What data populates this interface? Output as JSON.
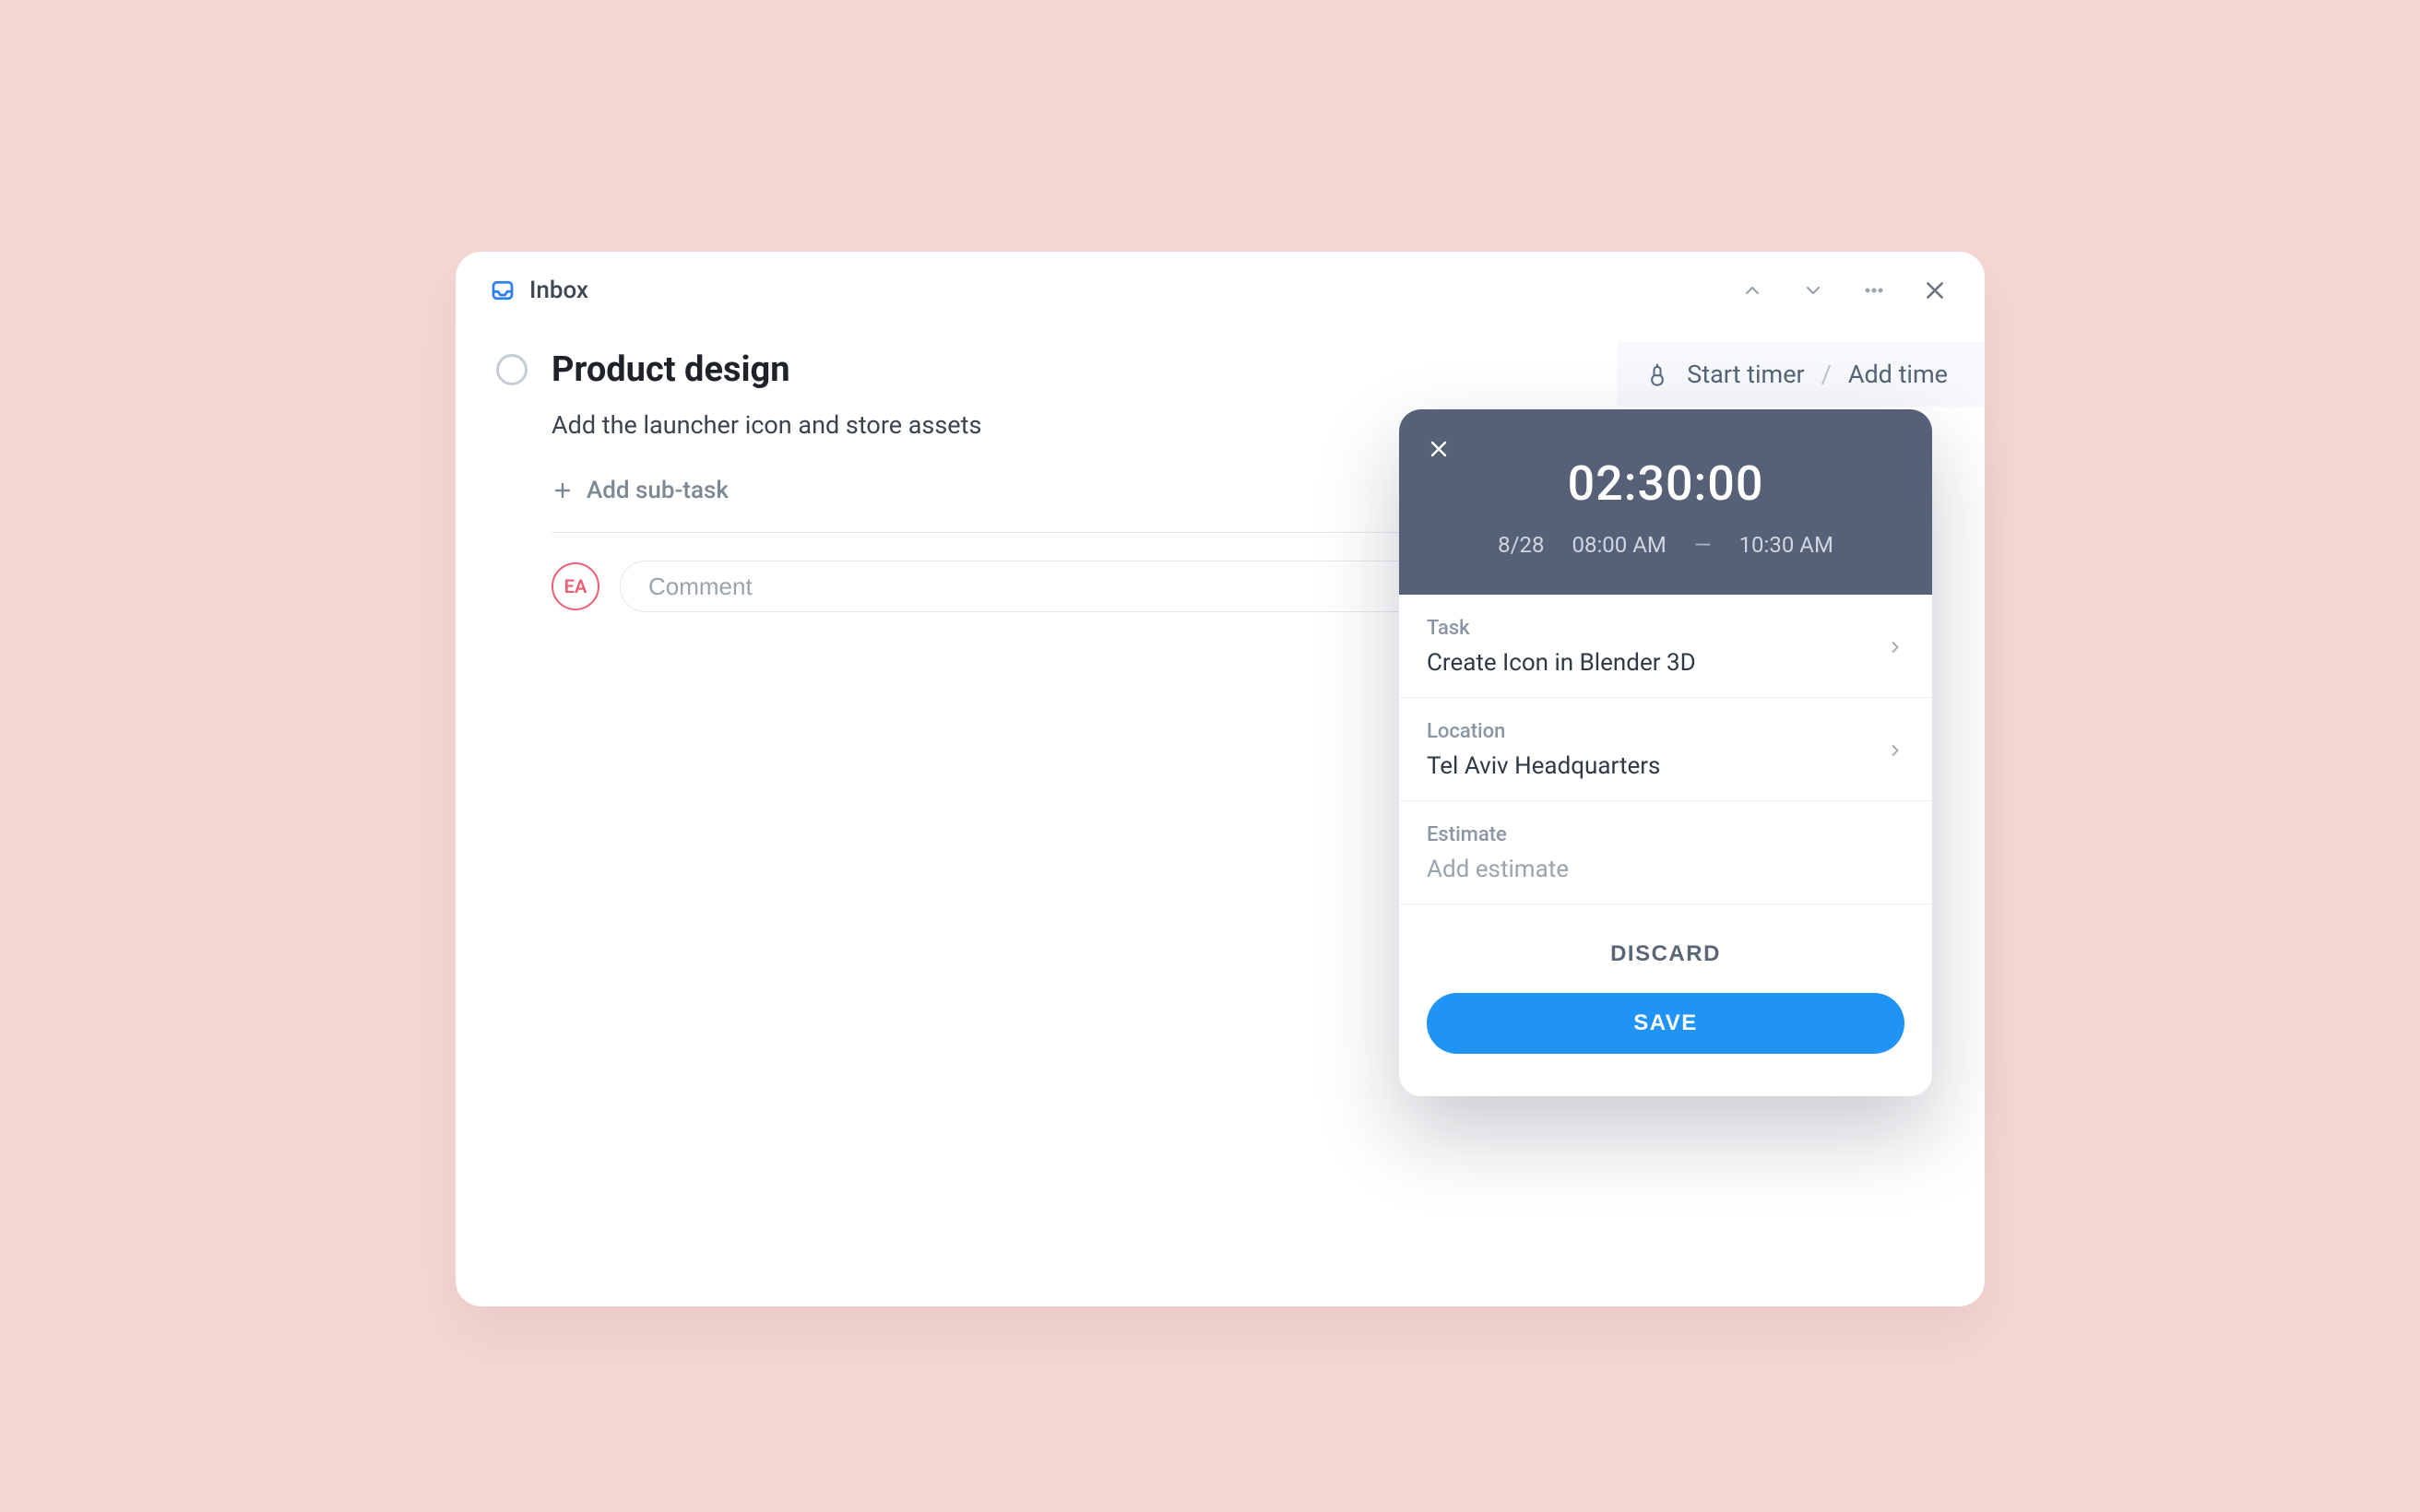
{
  "header": {
    "inbox_label": "Inbox"
  },
  "tracker": {
    "start_label": "Start timer",
    "add_label": "Add time"
  },
  "task": {
    "title": "Product design",
    "description": "Add the launcher icon and store assets",
    "add_subtask_label": "Add sub-task",
    "avatar_initials": "EA",
    "comment_placeholder": "Comment"
  },
  "timer": {
    "duration": "02:30:00",
    "date": "8/28",
    "start": "08:00 AM",
    "end": "10:30 AM",
    "rows": {
      "task": {
        "label": "Task",
        "value": "Create Icon in Blender 3D"
      },
      "location": {
        "label": "Location",
        "value": "Tel Aviv Headquarters"
      },
      "estimate": {
        "label": "Estimate",
        "placeholder": "Add estimate"
      }
    },
    "discard_label": "DISCARD",
    "save_label": "SAVE"
  }
}
